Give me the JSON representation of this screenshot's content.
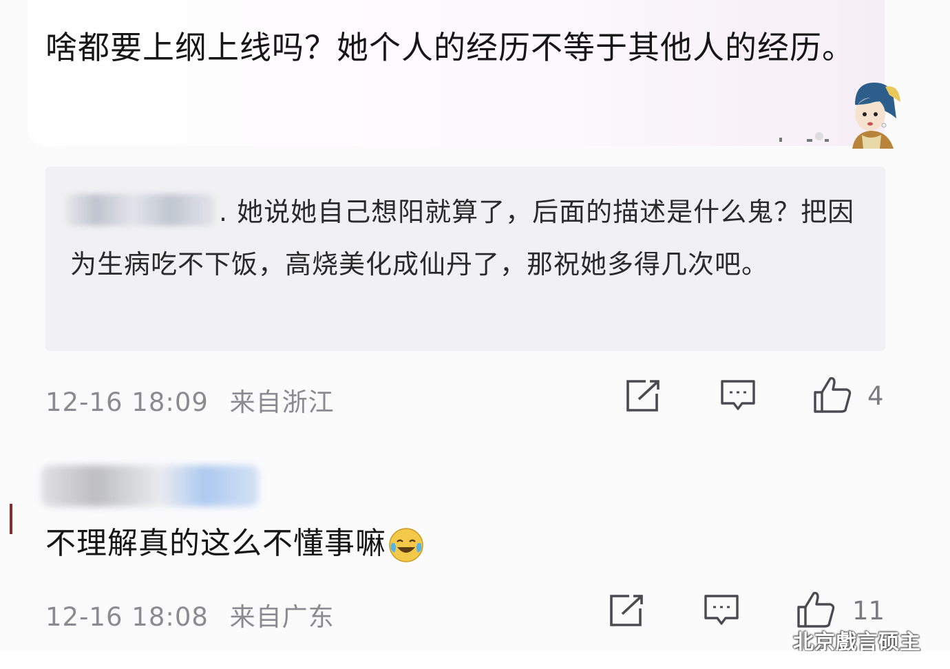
{
  "comment1": {
    "text": "啥都要上纲上线吗？她个人的经历不等于其他人的经历。"
  },
  "quote": {
    "text": ". 她说她自己想阳就算了，后面的描述是什么鬼？把因为生病吃不下饭，高烧美化成仙丹了，那祝她多得几次吧。"
  },
  "meta1": {
    "time": "12-16 18:09",
    "location": "来自浙江",
    "like_count": "4"
  },
  "comment2": {
    "text": "不理解真的这么不懂事嘛"
  },
  "meta2": {
    "time": "12-16 18:08",
    "location": "来自广东",
    "like_count": "11"
  },
  "watermark": {
    "text": "北京戲言硕主"
  },
  "icons": {
    "repost": "repost-icon",
    "comment": "comment-icon",
    "like": "like-icon",
    "emoji": "laugh-cry-emoji-icon",
    "sticker": "girl-with-pearl-earring-sticker-icon"
  }
}
